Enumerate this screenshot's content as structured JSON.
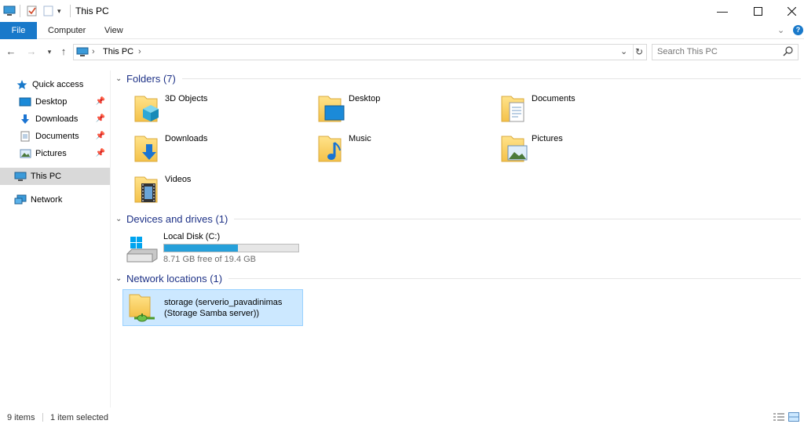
{
  "window": {
    "title": "This PC"
  },
  "ribbon": {
    "tabs": [
      "File",
      "Computer",
      "View"
    ]
  },
  "address": {
    "location": "This PC",
    "separator": "›"
  },
  "search": {
    "placeholder": "Search This PC"
  },
  "sidebar": {
    "quick_access": "Quick access",
    "pinned": [
      "Desktop",
      "Downloads",
      "Documents",
      "Pictures"
    ],
    "this_pc": "This PC",
    "network": "Network"
  },
  "folders": {
    "header": "Folders (7)",
    "items": [
      "3D Objects",
      "Desktop",
      "Documents",
      "Downloads",
      "Music",
      "Pictures",
      "Videos"
    ]
  },
  "devices": {
    "header": "Devices and drives (1)",
    "drive_name": "Local Disk (C:)",
    "free_text": "8.71 GB free of 19.4 GB",
    "used_fraction": 0.551
  },
  "network_locations": {
    "header": "Network locations (1)",
    "item_line1": "storage (serverio_pavadinimas",
    "item_line2": "(Storage Samba server))"
  },
  "status": {
    "item_count": "9 items",
    "selection": "1 item selected"
  },
  "colors": {
    "accent": "#1979ca",
    "selection_bg": "#cce8ff",
    "drive_fill": "#26a0da",
    "header_text": "#1e3287"
  }
}
